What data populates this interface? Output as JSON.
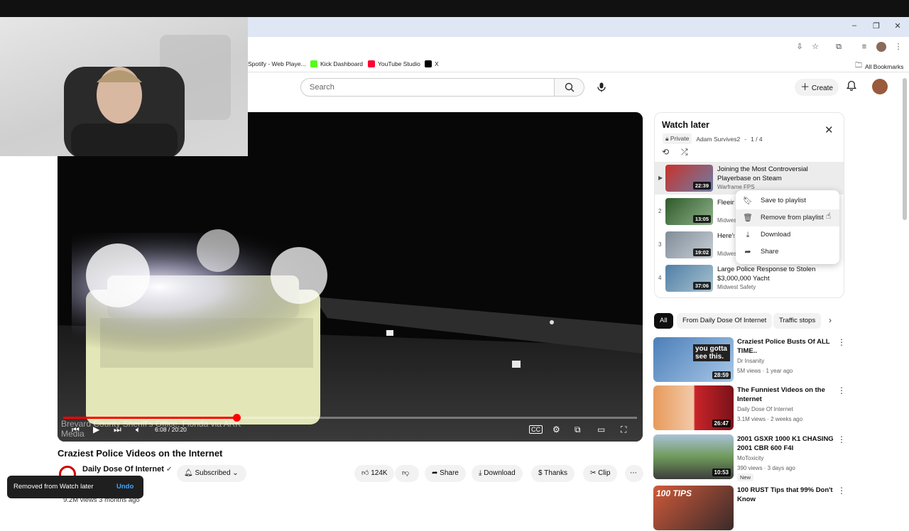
{
  "bookmarks": [
    {
      "label": "Spotify - Web Playe...",
      "color": "#1db954"
    },
    {
      "label": "Kick Dashboard",
      "color": "#53fc18"
    },
    {
      "label": "YouTube Studio",
      "color": "#ff0033"
    },
    {
      "label": "X",
      "color": "#000000"
    }
  ],
  "all_bookmarks": "All Bookmarks",
  "header": {
    "search_placeholder": "Search",
    "create_label": "Create"
  },
  "player": {
    "time_current": "6:08",
    "time_total": "20:20",
    "time_display": "6:08 / 20:20",
    "progress_fraction": 0.302,
    "watermark": "Brevard County Sheriff's Office, Florida via ARK Media"
  },
  "video": {
    "title": "Craziest Police Videos on the Internet",
    "channel": "Daily Dose Of Internet",
    "subscribe_label": "Subscribed",
    "likes": "124K",
    "share_label": "Share",
    "download_label": "Download",
    "thanks_label": "Thanks",
    "clip_label": "Clip",
    "views_line": "9.2M views  3 months ago"
  },
  "toast": {
    "message": "Removed from Watch later",
    "action": "Undo"
  },
  "playlist": {
    "title": "Watch later",
    "privacy": "Private",
    "owner": "Adam Survives2",
    "position": "1 / 4",
    "items": [
      {
        "index": "▶",
        "title": "Joining the Most Controversial Playerbase on Steam",
        "channel": "Warframe FPS",
        "duration": "22:39"
      },
      {
        "index": "2",
        "title": "Fleeing Suspect Crashes $100,000 Car",
        "channel": "Midwest Safety",
        "duration": "13:05"
      },
      {
        "index": "3",
        "title": "Here's What Happens When Referees Get Arrested",
        "channel": "Midwest Safety",
        "duration": "19:02"
      },
      {
        "index": "4",
        "title": "Large Police Response to Stolen $3,000,000 Yacht",
        "channel": "Midwest Safety",
        "duration": "37:06"
      }
    ]
  },
  "context_menu": {
    "items": [
      {
        "label": "Save to playlist",
        "icon": "bookmark-icon"
      },
      {
        "label": "Remove from playlist",
        "icon": "trash-icon"
      },
      {
        "label": "Download",
        "icon": "download-icon"
      },
      {
        "label": "Share",
        "icon": "share-icon"
      }
    ]
  },
  "chips": [
    "All",
    "From Daily Dose Of Internet",
    "Traffic stops"
  ],
  "recommendations": [
    {
      "title": "Craziest Police Busts Of ALL TIME..",
      "channel": "Dr Insanity",
      "meta": "5M views · 1 year ago",
      "duration": "28:59",
      "thumb_text": "you gotta see this."
    },
    {
      "title": "The Funniest Videos on the Internet",
      "channel": "Daily Dose Of Internet",
      "meta": "3.1M views · 2 weeks ago",
      "duration": "26:47"
    },
    {
      "title": "2001 GSXR 1000 K1 CHASING 2001 CBR 600 F4I",
      "channel": "MoToxicity",
      "meta": "390 views · 3 days ago",
      "duration": "10:53",
      "badge": "New"
    },
    {
      "title": "100 RUST Tips that 99% Don't Know",
      "channel": "",
      "meta": "",
      "duration": "",
      "thumb_text": "100 TIPS"
    }
  ]
}
